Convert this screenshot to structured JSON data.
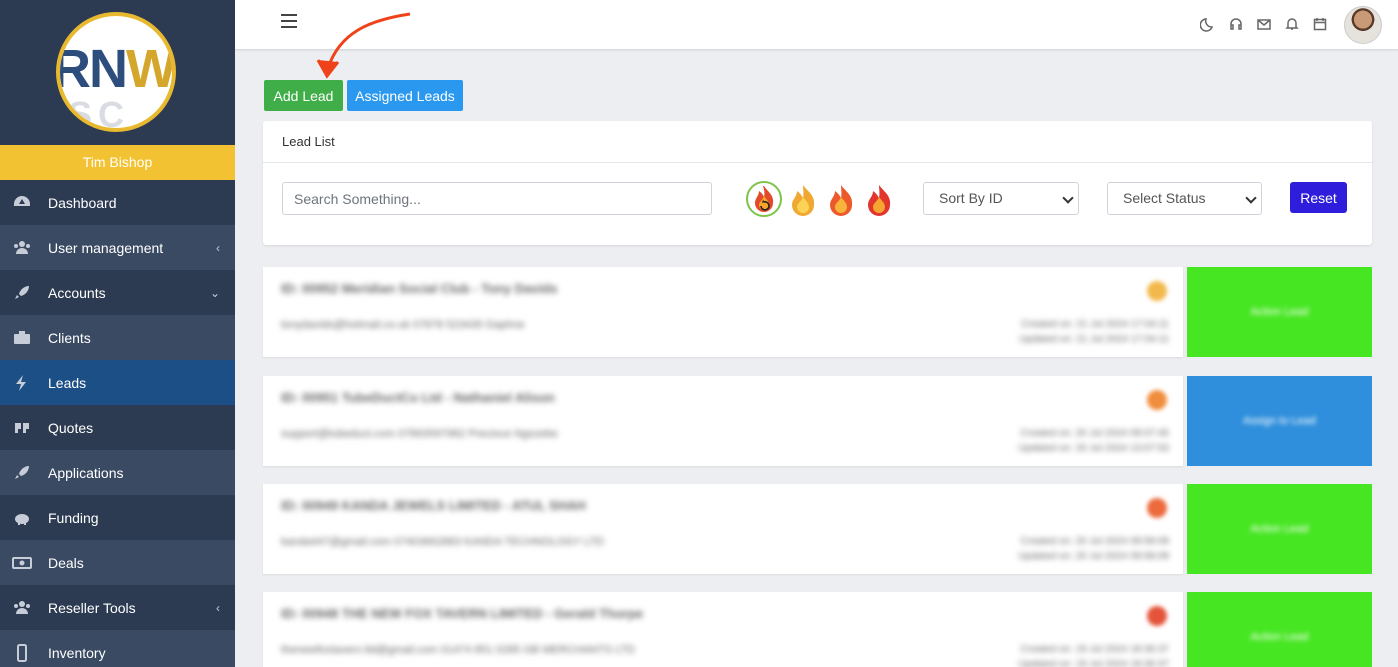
{
  "sidebar": {
    "username": "Tim Bishop",
    "logo": {
      "letters": "RNW",
      "sub": "SC"
    },
    "items": [
      {
        "label": "Dashboard",
        "icon": "dashboard-icon",
        "caret": ""
      },
      {
        "label": "User management",
        "icon": "users-icon",
        "caret": "‹"
      },
      {
        "label": "Accounts",
        "icon": "rocket-icon",
        "caret": "⌄"
      },
      {
        "label": "Clients",
        "icon": "briefcase-icon",
        "caret": ""
      },
      {
        "label": "Leads",
        "icon": "bolt-icon",
        "caret": ""
      },
      {
        "label": "Quotes",
        "icon": "quote-icon",
        "caret": ""
      },
      {
        "label": "Applications",
        "icon": "rocket-icon",
        "caret": ""
      },
      {
        "label": "Funding",
        "icon": "piggy-bank-icon",
        "caret": ""
      },
      {
        "label": "Deals",
        "icon": "money-icon",
        "caret": ""
      },
      {
        "label": "Reseller Tools",
        "icon": "users-icon",
        "caret": "‹"
      },
      {
        "label": "Inventory",
        "icon": "mobile-icon",
        "caret": ""
      }
    ]
  },
  "topbar": {
    "icons": [
      "moon-icon",
      "headset-icon",
      "mail-icon",
      "bell-icon",
      "calendar-icon"
    ]
  },
  "actions": {
    "add_lead": "Add Lead",
    "assigned_leads": "Assigned Leads"
  },
  "lead_list": {
    "title": "Lead List",
    "search_placeholder": "Search Something...",
    "sort_selected": "Sort By ID",
    "status_selected": "Select Status",
    "reset": "Reset",
    "flame_filters": [
      "flame-reset-icon",
      "flame-warm-icon",
      "flame-hot-icon",
      "flame-very-hot-icon"
    ]
  },
  "leads": [
    {
      "title": "ID: 00952 Meridian Social Club - Tony Davids",
      "meta": "tonydavids@hotmail.co.uk  07878 523435  Daphne",
      "dates": [
        "Created on: 21 Jul 2024 17:04:11",
        "Updated on: 21 Jul 2024 17:04:11"
      ],
      "action": "Action Lead",
      "action_color": "#47e623",
      "status_color": "#f2b84b"
    },
    {
      "title": "ID: 00951 TubeDuctCo Ltd - Nathaniel Alison",
      "meta": "support@tubeduct.com  07893597982  Precious Ngozeke",
      "dates": [
        "Created on: 20 Jul 2024 09:07:45",
        "Updated on: 20 Jul 2024 13:07:53"
      ],
      "action": "Assign to Lead",
      "action_color": "#2f8fdc",
      "status_color": "#ef8e3c"
    },
    {
      "title": "ID: 00949 KANDA JEWELS LIMITED - ATUL SHAH",
      "meta": "kanda447@gmail.com  07403662883  KANDA TECHNOLOGY LTD",
      "dates": [
        "Created on: 20 Jul 2024 09:58:09",
        "Updated on: 20 Jul 2024 09:58:09"
      ],
      "action": "Action Lead",
      "action_color": "#47e623",
      "status_color": "#ec6a3c"
    },
    {
      "title": "ID: 00948 THE NEW FOX TAVERN LIMITED - Gerald Thorpe",
      "meta": "thenewfoxtavern.ltd@gmail.com  01474 851 0285  GB MERCHANTS LTD",
      "dates": [
        "Created on: 19 Jul 2024 18:36:37",
        "Updated on: 19 Jul 2024 18:36:37"
      ],
      "action": "Action Lead",
      "action_color": "#47e623",
      "status_color": "#e4543a"
    }
  ],
  "colors": {
    "sidebar_bg": "#2d3b52",
    "sidebar_active": "#1b4f86",
    "user_bar": "#f3c232",
    "add_lead": "#3fae49",
    "assigned_leads": "#2b98f0",
    "reset": "#2e1edb",
    "annotation_arrow": "#f0421a"
  }
}
